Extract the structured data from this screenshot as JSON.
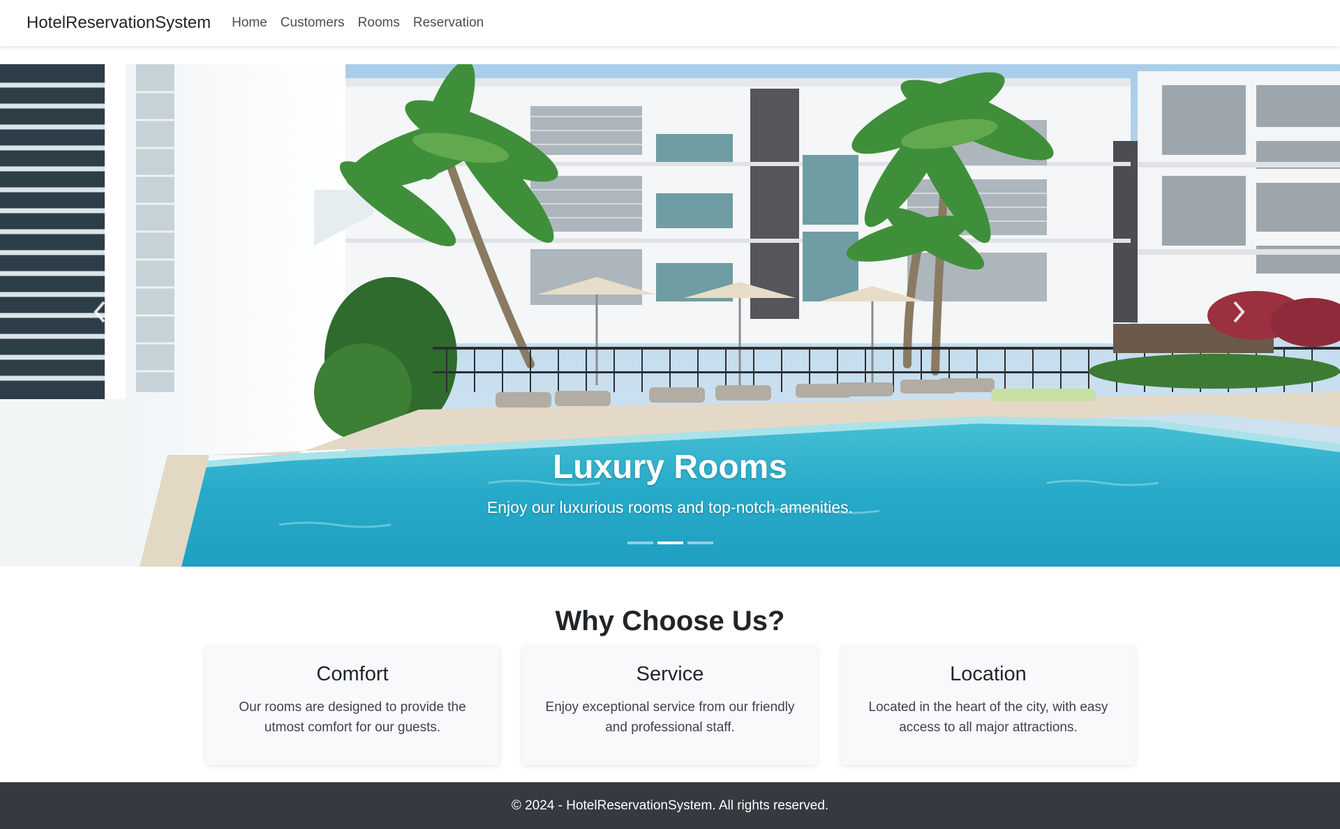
{
  "navbar": {
    "brand": "HotelReservationSystem",
    "links": [
      "Home",
      "Customers",
      "Rooms",
      "Reservation"
    ]
  },
  "carousel": {
    "title": "Luxury Rooms",
    "subtitle": "Enjoy our luxurious rooms and top-notch amenities.",
    "indicator_count": 3,
    "active_slide_index": 1,
    "prev_icon": "chevron-left-icon",
    "next_icon": "chevron-right-icon"
  },
  "features": {
    "heading": "Why Choose Us?",
    "cards": [
      {
        "title": "Comfort",
        "text": "Our rooms are designed to provide the utmost comfort for our guests."
      },
      {
        "title": "Service",
        "text": "Enjoy exceptional service from our friendly and professional staff."
      },
      {
        "title": "Location",
        "text": "Located in the heart of the city, with easy access to all major attractions."
      }
    ]
  },
  "footer": {
    "text": "© 2024 - HotelReservationSystem. All rights reserved."
  },
  "colors": {
    "footer_bg": "#343a40",
    "card_bg": "#f8f9fa",
    "pool": "#2fb3cf",
    "sky": "#bcd9ef"
  }
}
